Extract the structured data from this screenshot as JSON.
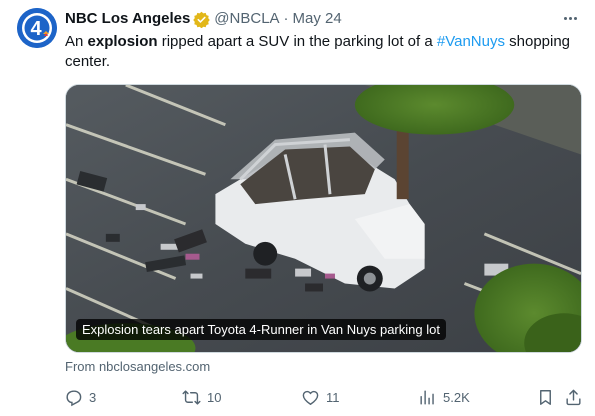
{
  "tweet": {
    "author": {
      "display_name": "NBC Los Angeles",
      "handle": "@NBCLA",
      "verified_badge": "gold-check-icon",
      "avatar_text": "4"
    },
    "separator": "·",
    "date": "May 24",
    "text": {
      "part1": "An ",
      "bold1": "explosion",
      "part2": " ripped apart a SUV in the parking lot of a ",
      "hashtag": "#VanNuys",
      "part3": " shopping center."
    },
    "media": {
      "caption": "Explosion tears apart Toyota 4-Runner in Van Nuys parking lot"
    },
    "source": "From nbclosangeles.com",
    "actions": {
      "reply_count": "3",
      "retweet_count": "10",
      "like_count": "11",
      "views_count": "5.2K"
    }
  },
  "colors": {
    "text_primary": "#0f1419",
    "text_secondary": "#536471",
    "link": "#1d9bf0",
    "verified_gold": "#e2b719",
    "avatar_bg": "#1d64c8"
  }
}
